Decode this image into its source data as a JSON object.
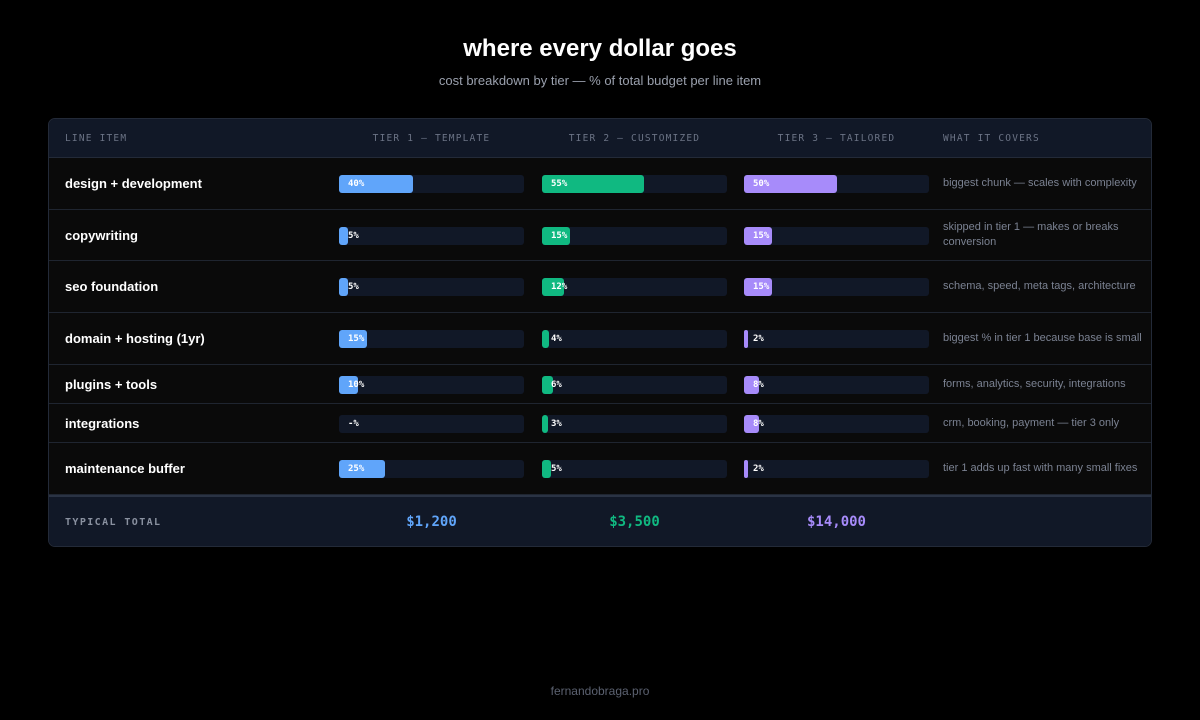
{
  "title": "where every dollar goes",
  "subtitle": "cost breakdown by tier — % of total budget per line item",
  "colors": {
    "tier1": "#60a5fa",
    "tier2": "#10b981",
    "tier3": "#a78bfa"
  },
  "chart_data": {
    "type": "table",
    "columns": [
      "line item",
      "tier 1 — template",
      "tier 2 — customized",
      "tier 3 — tailored",
      "what it covers"
    ],
    "rows": [
      {
        "item": "design + development",
        "t1": 40,
        "t1_label": "40%",
        "t2": 55,
        "t2_label": "55%",
        "t3": 50,
        "t3_label": "50%",
        "covers": "biggest chunk — scales with complexity"
      },
      {
        "item": "copywriting",
        "t1": 5,
        "t1_label": "5%",
        "t2": 15,
        "t2_label": "15%",
        "t3": 15,
        "t3_label": "15%",
        "covers": "skipped in tier 1 — makes or breaks conversion"
      },
      {
        "item": "seo foundation",
        "t1": 5,
        "t1_label": "5%",
        "t2": 12,
        "t2_label": "12%",
        "t3": 15,
        "t3_label": "15%",
        "covers": "schema, speed, meta tags, architecture"
      },
      {
        "item": "domain + hosting (1yr)",
        "t1": 15,
        "t1_label": "15%",
        "t2": 4,
        "t2_label": "4%",
        "t3": 2,
        "t3_label": "2%",
        "covers": "biggest % in tier 1 because base is small"
      },
      {
        "item": "plugins + tools",
        "t1": 10,
        "t1_label": "10%",
        "t2": 6,
        "t2_label": "6%",
        "t3": 8,
        "t3_label": "8%",
        "covers": "forms, analytics, security, integrations"
      },
      {
        "item": "integrations",
        "t1": 0,
        "t1_label": "-%",
        "t2": 3,
        "t2_label": "3%",
        "t3": 8,
        "t3_label": "8%",
        "covers": "crm, booking, payment — tier 3 only"
      },
      {
        "item": "maintenance buffer",
        "t1": 25,
        "t1_label": "25%",
        "t2": 5,
        "t2_label": "5%",
        "t3": 2,
        "t3_label": "2%",
        "covers": "tier 1 adds up fast with many small fixes"
      }
    ],
    "bar_max": 100,
    "total_label": "typical total",
    "totals": [
      "$1,200",
      "$3,500",
      "$14,000"
    ]
  },
  "footer": "fernandobraga.pro"
}
